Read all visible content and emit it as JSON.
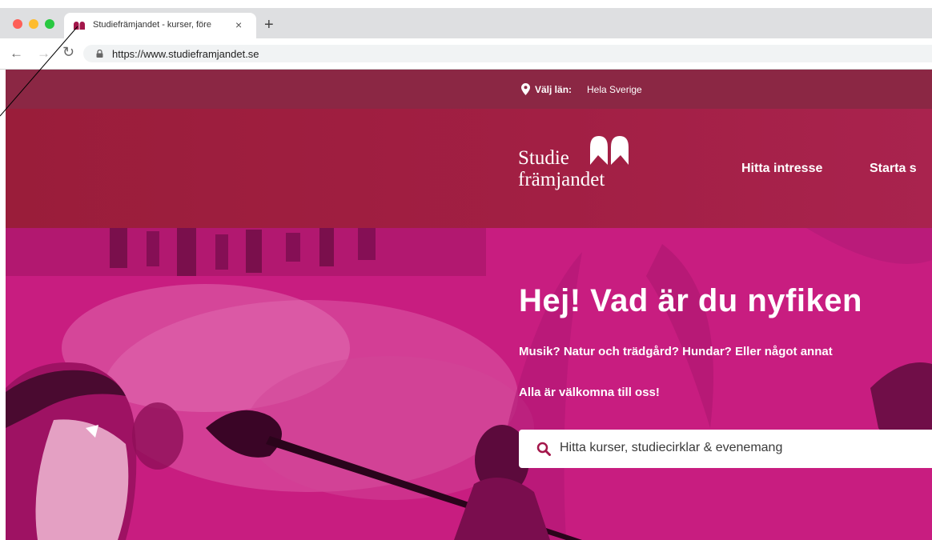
{
  "browser": {
    "tab_title": "Studiefrämjandet - kurser, före",
    "tab_close": "×",
    "new_tab": "+",
    "nav_back": "←",
    "nav_forward": "→",
    "nav_reload": "↻",
    "url": "https://www.studieframjandet.se"
  },
  "topbar": {
    "lan_label": "Välj län:",
    "lan_value": "Hela Sverige"
  },
  "header": {
    "logo_line1": "Studie",
    "logo_line2": "främjandet",
    "nav": [
      "Hitta intresse",
      "Starta s"
    ]
  },
  "hero": {
    "title": "Hej! Vad är du nyfiken",
    "subtitle": "Musik? Natur och trädgård? Hundar? Eller något annat",
    "welcome": "Alla är välkomna till oss!",
    "search_placeholder": "Hitta kurser, studiecirklar & evenemang"
  },
  "colors": {
    "brand_dark": "#8b2744",
    "brand_header": "#a21f44",
    "hero_magenta": "#c81d80",
    "search_icon": "#a3164a"
  },
  "icons": {
    "favicon": "book-icon",
    "lock": "lock-icon",
    "location": "pin-icon",
    "search": "search-icon"
  }
}
